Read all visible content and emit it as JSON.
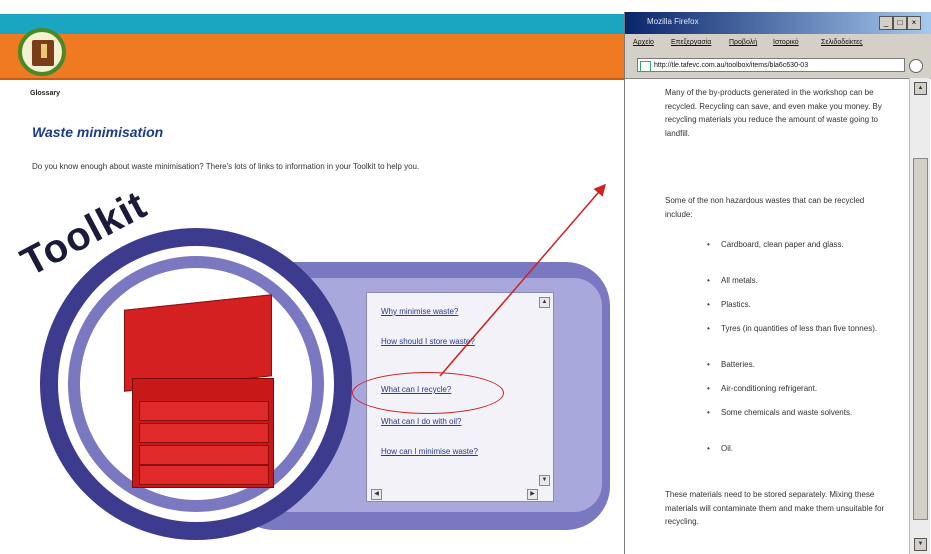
{
  "header": {
    "glossary_label": "Glossary"
  },
  "page": {
    "title": "Waste minimisation",
    "intro": "Do you know enough about waste minimisation? There's lots of links to information in your Toolkit to help you.",
    "toolkit_word": "Toolkit"
  },
  "links": [
    "Why minimise waste?",
    "How should I store waste?",
    "What can I recycle?",
    "What can I do with oil?",
    "How can I minimise waste?"
  ],
  "browser": {
    "title": "Mozilla Firefox",
    "menu": [
      "Αρχείο",
      "Επεξεργασία",
      "Προβολή",
      "Ιστορικό",
      "Σελιδοδείκτες"
    ],
    "address": "http://tle.tafevc.com.au/toolbox/items/bla6c630-03",
    "content": {
      "para1": "Many of the by-products generated in the workshop can be recycled. Recycling can save, and even make you money. By recycling materials you reduce the amount of waste going to landfill.",
      "para2": "Some of the non hazardous wastes that can be recycled include:",
      "bullets": [
        "Cardboard, clean paper and glass.",
        "All metals.",
        "Plastics.",
        "Tyres (in quantities of less than five tonnes).",
        "Batteries.",
        "Air-conditioning refrigerant.",
        "Some chemicals and waste solvents.",
        "Oil."
      ],
      "para3": "These materials need to be stored separately. Mixing these materials will contaminate them and make them unsuitable for recycling."
    }
  },
  "colors": {
    "cyan_bar": "#1aa6c0",
    "orange_bar": "#f07a22",
    "title_blue": "#1b3a8a",
    "ring_dark": "#3d3b8e",
    "ring_light": "#7a78c0",
    "toolbox_red": "#c81818",
    "highlight_red": "#d02020"
  }
}
